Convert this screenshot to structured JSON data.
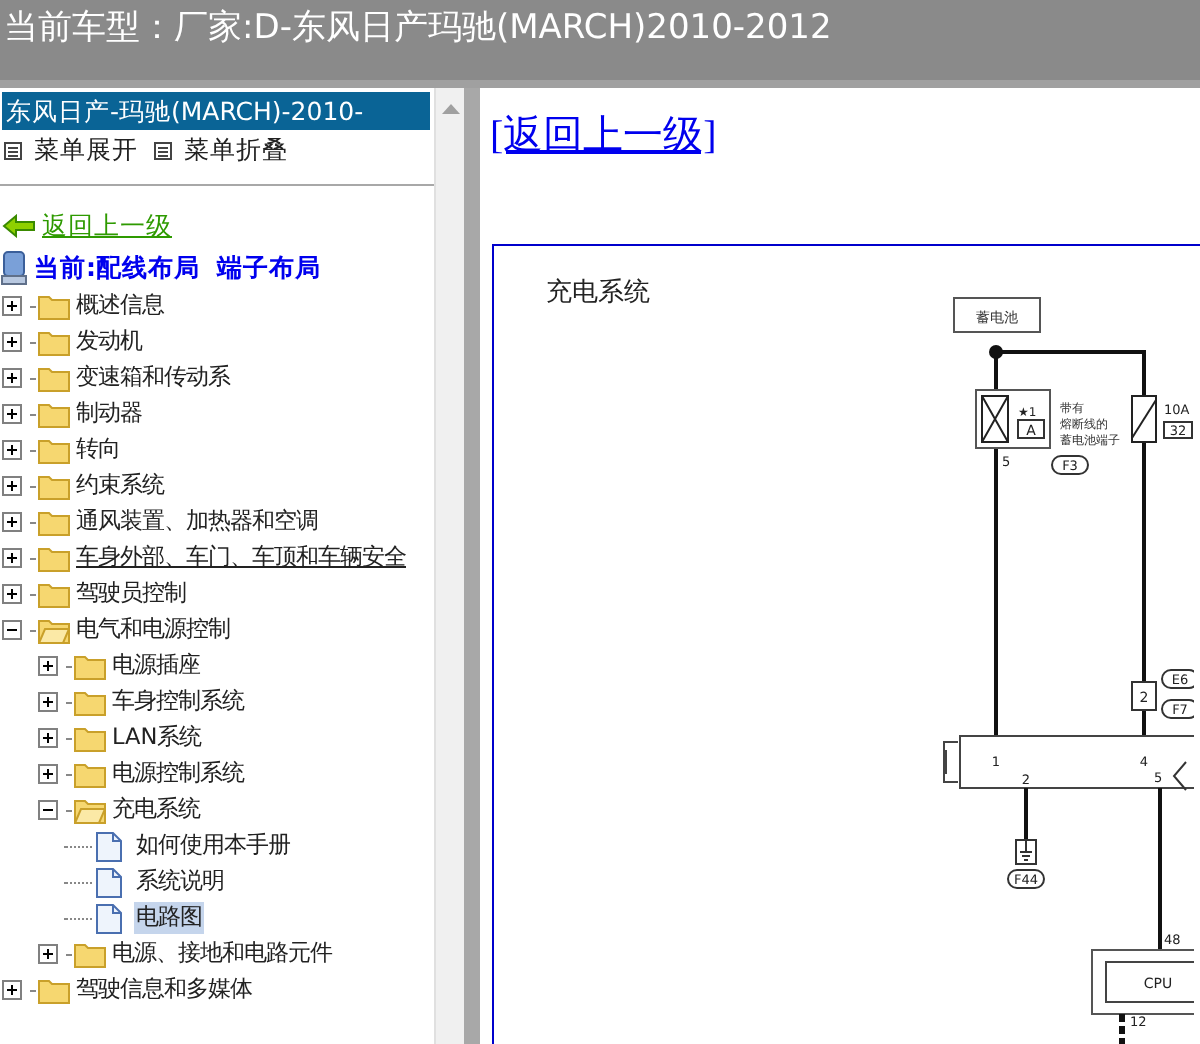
{
  "title_bar": {
    "text": "当前车型：厂家:D-东风日产玛驰(MARCH)2010-2012"
  },
  "sidebar": {
    "header": "东风日产-玛驰(MARCH)-2010-",
    "menu_actions": [
      {
        "label": "菜单展开"
      },
      {
        "label": "菜单折叠"
      }
    ],
    "back_link": "返回上一级",
    "current_path": "当前:配线布局  端子布局",
    "tree": [
      {
        "label": "概述信息",
        "kind": "folder",
        "expanded": false,
        "selected": false,
        "hovered": false
      },
      {
        "label": "发动机",
        "kind": "folder",
        "expanded": false,
        "selected": false,
        "hovered": false
      },
      {
        "label": "变速箱和传动系",
        "kind": "folder",
        "expanded": false,
        "selected": false,
        "hovered": false
      },
      {
        "label": "制动器",
        "kind": "folder",
        "expanded": false,
        "selected": false,
        "hovered": false
      },
      {
        "label": "转向",
        "kind": "folder",
        "expanded": false,
        "selected": false,
        "hovered": false
      },
      {
        "label": "约束系统",
        "kind": "folder",
        "expanded": false,
        "selected": false,
        "hovered": false
      },
      {
        "label": "通风装置、加热器和空调",
        "kind": "folder",
        "expanded": false,
        "selected": false,
        "hovered": false
      },
      {
        "label": "车身外部、车门、车顶和车辆安全",
        "kind": "folder",
        "expanded": false,
        "selected": false,
        "hovered": true
      },
      {
        "label": "驾驶员控制",
        "kind": "folder",
        "expanded": false,
        "selected": false,
        "hovered": false
      },
      {
        "label": "电气和电源控制",
        "kind": "folder",
        "expanded": true,
        "selected": false,
        "hovered": false,
        "children": [
          {
            "label": "电源插座",
            "kind": "folder",
            "expanded": false,
            "selected": false,
            "hovered": false
          },
          {
            "label": "车身控制系统",
            "kind": "folder",
            "expanded": false,
            "selected": false,
            "hovered": false
          },
          {
            "label": "LAN系统",
            "kind": "folder",
            "expanded": false,
            "selected": false,
            "hovered": false
          },
          {
            "label": "电源控制系统",
            "kind": "folder",
            "expanded": false,
            "selected": false,
            "hovered": false
          },
          {
            "label": "充电系统",
            "kind": "folder",
            "expanded": true,
            "selected": false,
            "hovered": false,
            "children": [
              {
                "label": "如何使用本手册",
                "kind": "page",
                "selected": false,
                "hovered": false
              },
              {
                "label": "系统说明",
                "kind": "page",
                "selected": false,
                "hovered": false
              },
              {
                "label": "电路图",
                "kind": "page",
                "selected": true,
                "hovered": false
              }
            ]
          },
          {
            "label": "电源、接地和电路元件",
            "kind": "folder",
            "expanded": false,
            "selected": false,
            "hovered": false
          }
        ]
      },
      {
        "label": "驾驶信息和多媒体",
        "kind": "folder",
        "expanded": false,
        "selected": false,
        "hovered": false
      }
    ]
  },
  "content": {
    "back_link": "[返回上一级]",
    "diagram": {
      "title": "充电系统",
      "battery": "蓄电池",
      "fuse_mark": "★1",
      "fuse_connector": "A",
      "fuse_note": [
        "带有",
        "熔断线的",
        "蓄电池端子"
      ],
      "fuse_connector_id": "F3",
      "fuse_pin": "5",
      "fuse2_rating": "10A",
      "fuse2_pin": "32",
      "harness_connectors": [
        "E6",
        "F7"
      ],
      "harness_pin": "2",
      "module_pins": [
        "1",
        "4",
        "2",
        "5"
      ],
      "ground_id": "F44",
      "cpu_pin_in": "48",
      "cpu": "CPU",
      "cpu_pin_out": "12"
    }
  }
}
